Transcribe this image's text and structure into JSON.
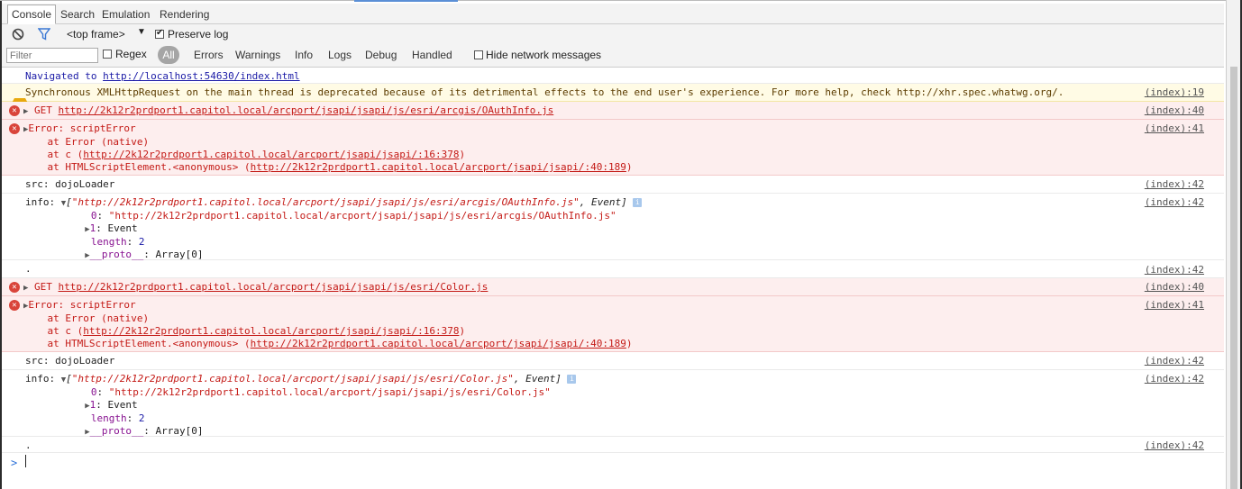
{
  "tabs": [
    "Console",
    "Search",
    "Emulation",
    "Rendering"
  ],
  "toolbar": {
    "frame_label": "<top frame>",
    "preserve_log_label": "Preserve log",
    "filter_placeholder": "Filter",
    "regex_label": "Regex",
    "all_label": "All",
    "levels": [
      "Errors",
      "Warnings",
      "Info",
      "Logs",
      "Debug",
      "Handled"
    ],
    "hide_network_label": "Hide network messages"
  },
  "console": {
    "navigated_prefix": "Navigated to ",
    "navigated_url": "http://localhost:54630/index.html",
    "warning": "Synchronous XMLHttpRequest on the main thread is deprecated because of its detrimental effects to the end user's experience. For more help, check http://xhr.spec.whatwg.org/.",
    "warning_src": "(index):19",
    "get1_prefix": "GET ",
    "get1_url": "http://2k12r2prdport1.capitol.local/arcport/jsapi/jsapi/js/esri/arcgis/OAuthInfo.js",
    "get1_src": "(index):40",
    "err1": {
      "l1": "Error: scriptError",
      "l2": "    at Error (native)",
      "l3_prefix": "    at c (",
      "l3_url": "http://2k12r2prdport1.capitol.local/arcport/jsapi/jsapi/:16:378",
      "l3_suffix": ")",
      "l4_prefix": "    at HTMLScriptElement.<anonymous> (",
      "l4_url": "http://2k12r2prdport1.capitol.local/arcport/jsapi/jsapi/:40:189",
      "l4_suffix": ")",
      "src": "(index):41"
    },
    "src1": "src: dojoLoader",
    "src1_src": "(index):42",
    "info1": {
      "prefix": "info: ",
      "head_open": "[",
      "head_str": "\"http://2k12r2prdport1.capitol.local/arcport/jsapi/jsapi/js/esri/arcgis/OAuthInfo.js\"",
      "head_rest": ", Event]",
      "k0": "0",
      "v0": "\"http://2k12r2prdport1.capitol.local/arcport/jsapi/jsapi/js/esri/arcgis/OAuthInfo.js\"",
      "k1": "1",
      "v1": "Event",
      "klen": "length",
      "vlen": "2",
      "kproto": "__proto__",
      "vproto": "Array[0]",
      "src": "(index):42"
    },
    "dot1": ".",
    "dot1_src": "(index):42",
    "get2_prefix": "GET ",
    "get2_url": "http://2k12r2prdport1.capitol.local/arcport/jsapi/jsapi/js/esri/Color.js",
    "get2_src": "(index):40",
    "err2": {
      "l1": "Error: scriptError",
      "l2": "    at Error (native)",
      "l3_prefix": "    at c (",
      "l3_url": "http://2k12r2prdport1.capitol.local/arcport/jsapi/jsapi/:16:378",
      "l3_suffix": ")",
      "l4_prefix": "    at HTMLScriptElement.<anonymous> (",
      "l4_url": "http://2k12r2prdport1.capitol.local/arcport/jsapi/jsapi/:40:189",
      "l4_suffix": ")",
      "src": "(index):41"
    },
    "src2": "src: dojoLoader",
    "src2_src": "(index):42",
    "info2": {
      "prefix": "info: ",
      "head_open": "[",
      "head_str": "\"http://2k12r2prdport1.capitol.local/arcport/jsapi/jsapi/js/esri/Color.js\"",
      "head_rest": ", Event]",
      "k0": "0",
      "v0": "\"http://2k12r2prdport1.capitol.local/arcport/jsapi/jsapi/js/esri/Color.js\"",
      "k1": "1",
      "v1": "Event",
      "klen": "length",
      "vlen": "2",
      "kproto": "__proto__",
      "vproto": "Array[0]",
      "src": "(index):42"
    },
    "dot2": ".",
    "dot2_src": "(index):42",
    "prompt": ">"
  }
}
